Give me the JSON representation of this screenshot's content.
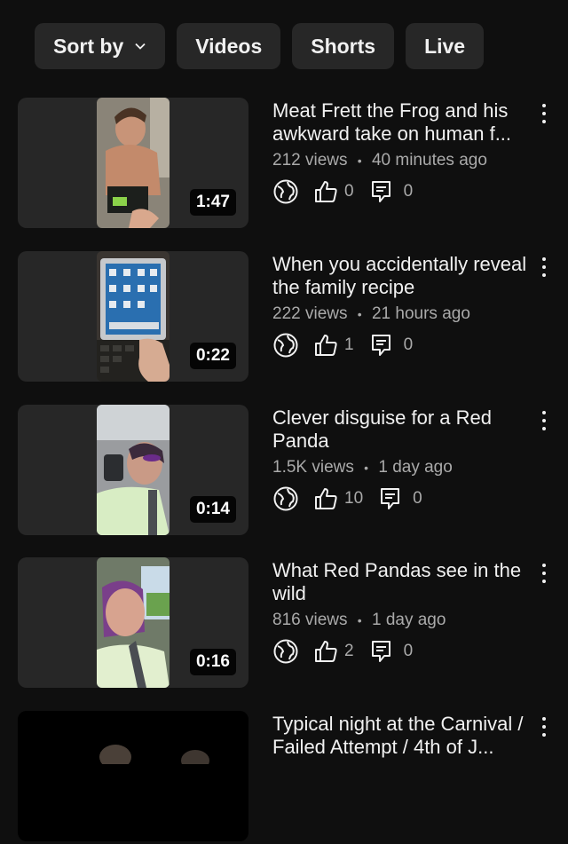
{
  "filters": [
    {
      "label": "Sort by",
      "has_chevron": true
    },
    {
      "label": "Videos"
    },
    {
      "label": "Shorts"
    },
    {
      "label": "Live"
    }
  ],
  "videos": [
    {
      "title": "Meat Frett the Frog and his awkward take on human f...",
      "views": "212 views",
      "age": "40 minutes ago",
      "likes": "0",
      "comments": "0",
      "duration": "1:47",
      "visibility_icon": "globe-icon"
    },
    {
      "title": "When you accidentally reveal the family recipe",
      "views": "222 views",
      "age": "21 hours ago",
      "likes": "1",
      "comments": "0",
      "duration": "0:22",
      "visibility_icon": "globe-icon"
    },
    {
      "title": "Clever disguise for a Red Panda",
      "views": "1.5K views",
      "age": "1 day ago",
      "likes": "10",
      "comments": "0",
      "duration": "0:14",
      "visibility_icon": "globe-icon"
    },
    {
      "title": "What Red Pandas see in the wild",
      "views": "816 views",
      "age": "1 day ago",
      "likes": "2",
      "comments": "0",
      "duration": "0:16",
      "visibility_icon": "globe-icon"
    },
    {
      "title": "Typical night at the Carnival / Failed Attempt / 4th of J...",
      "views": "",
      "age": "",
      "likes": "",
      "comments": "",
      "duration": "",
      "visibility_icon": "globe-icon"
    }
  ],
  "meta_separator": "•"
}
